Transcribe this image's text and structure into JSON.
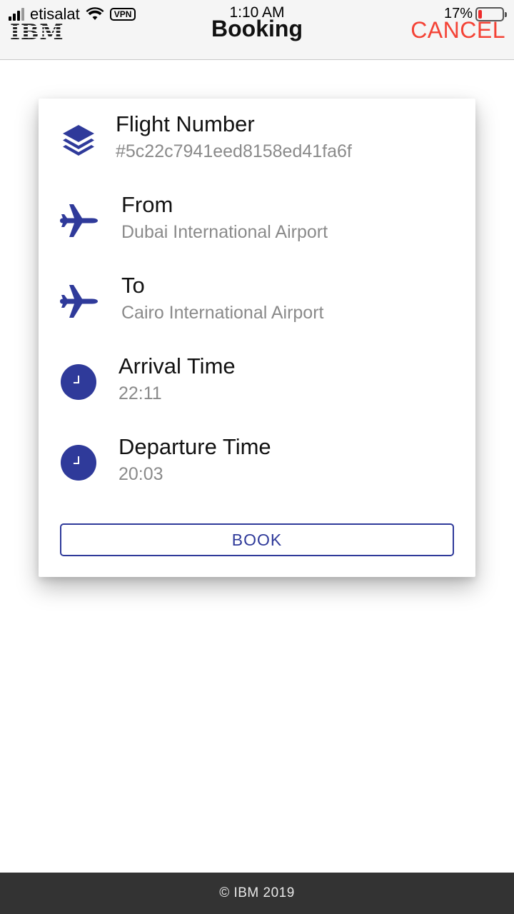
{
  "status_bar": {
    "carrier": "etisalat",
    "vpn": "VPN",
    "time": "1:10 AM",
    "battery_percent": "17%",
    "battery_level": 0.17
  },
  "header": {
    "logo": "IBM",
    "title": "Booking",
    "cancel_label": "CANCEL"
  },
  "booking": {
    "flight_number": {
      "label": "Flight Number",
      "value": "#5c22c7941eed8158ed41fa6f",
      "icon": "layers-icon"
    },
    "from": {
      "label": "From",
      "value": "Dubai International Airport",
      "icon": "airplane-icon"
    },
    "to": {
      "label": "To",
      "value": "Cairo International Airport",
      "icon": "airplane-icon"
    },
    "arrival": {
      "label": "Arrival Time",
      "value": "22:11",
      "icon": "clock-icon"
    },
    "departure": {
      "label": "Departure Time",
      "value": "20:03",
      "icon": "clock-icon"
    },
    "book_label": "BOOK"
  },
  "footer": {
    "text": "© IBM 2019"
  },
  "colors": {
    "accent": "#2f3a9a",
    "cancel": "#f44336",
    "footer_bg": "#333333",
    "battery": "#ee2b2b"
  }
}
